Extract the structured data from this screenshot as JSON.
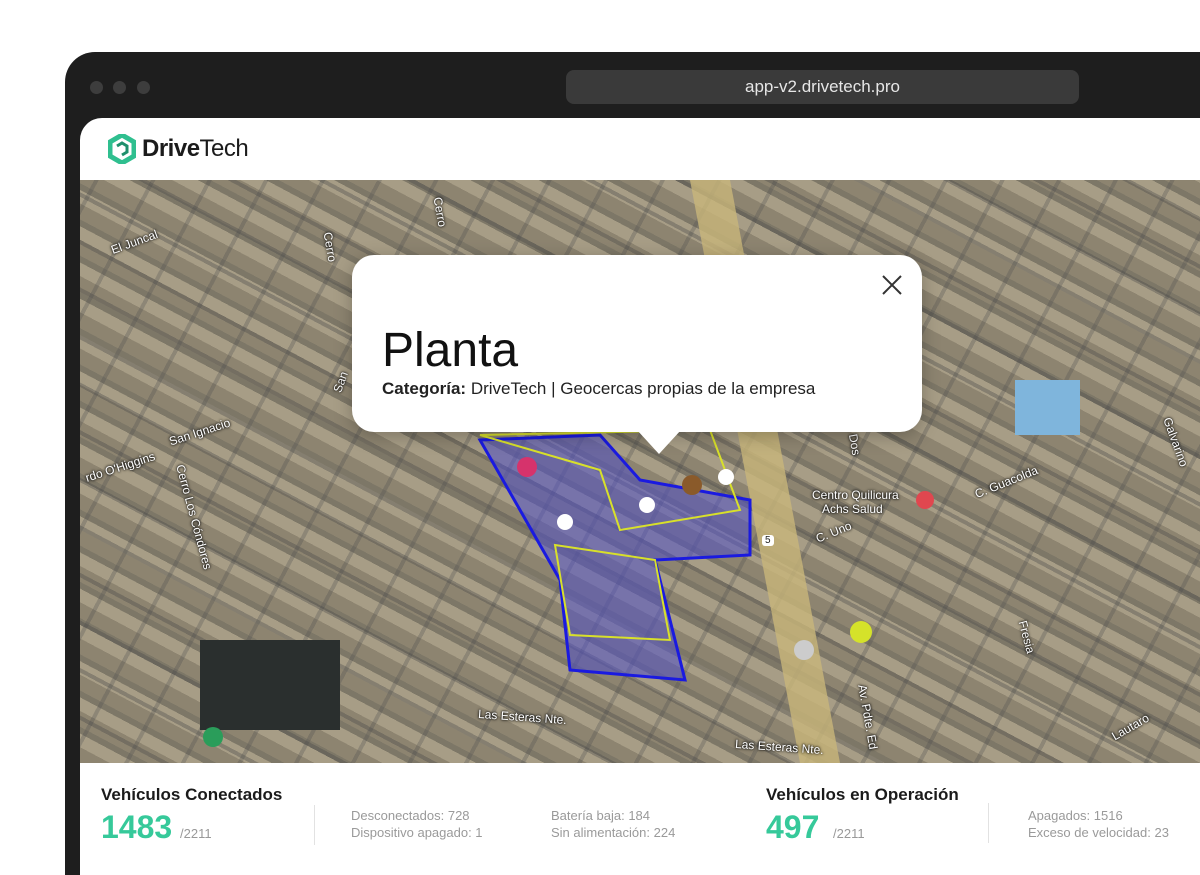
{
  "browser": {
    "url": "app-v2.drivetech.pro"
  },
  "brand": {
    "bold": "Drive",
    "light": "Tech",
    "accent": "#36c99a"
  },
  "map": {
    "labels": [
      "El Juncal",
      "San Ignacio",
      "rdo O'Higgins",
      "Cerro Los Cóndores",
      "Las Esteras Nte.",
      "Las Esteras Nte.",
      "Centro Quilicura",
      "Achs Salud",
      "C. Guacolda",
      "C. Uno",
      "C. Dos",
      "Fresia",
      "Galvarino",
      "Lautaro",
      "Av. Pdte. Ed",
      "5",
      "Cerro",
      "Cerro",
      "San"
    ]
  },
  "popup": {
    "title": "Planta",
    "category_label": "Categoría:",
    "category_value": "DriveTech | Geocercas propias de la empresa"
  },
  "stats": {
    "connected": {
      "title": "Vehículos Conectados",
      "value": "1483",
      "total": "/2211",
      "details": [
        "Desconectados: 728",
        "Dispositivo apagado: 1",
        "Batería baja: 184",
        "Sin alimentación: 224"
      ]
    },
    "operation": {
      "title": "Vehículos en Operación",
      "value": "497",
      "total": "/2211",
      "details": [
        "Apagados: 1516",
        "Exceso de velocidad: 23"
      ]
    }
  }
}
